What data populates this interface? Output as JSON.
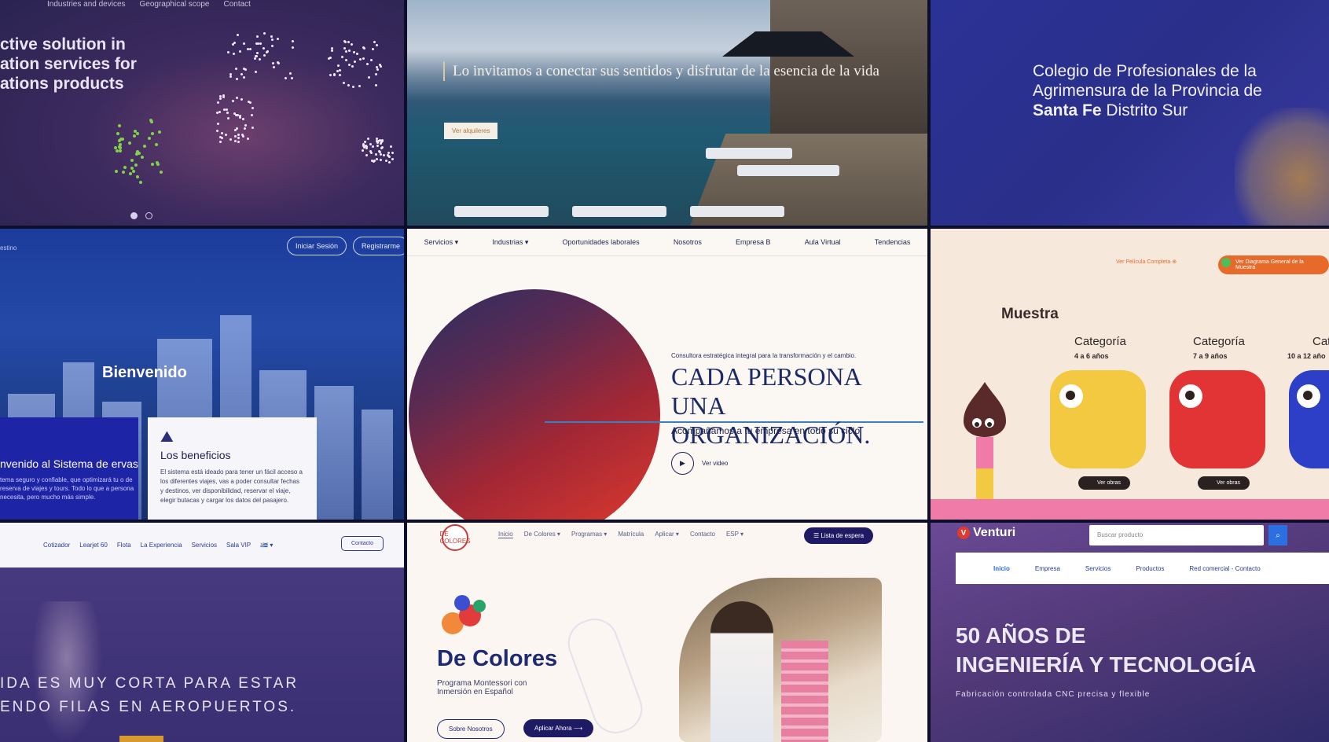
{
  "tiles": {
    "t1": {
      "nav": [
        "Industries and devices",
        "Geographical scope",
        "Contact"
      ],
      "headline": [
        "ctive solution in",
        "ation services for",
        "ations products"
      ]
    },
    "t2": {
      "headline": "Lo invitamos a conectar sus sentidos y disfrutar de la esencia de la vida",
      "button": "Ver alquileres"
    },
    "t3": {
      "headline_a": "Colegio de Profesionales de la Agrimensura de la Provincia de",
      "headline_b": "Santa Fe",
      "headline_c": " Distrito Sur"
    },
    "t4": {
      "brand": "estino",
      "login": "Iniciar Sesión",
      "register": "Registrarme",
      "welcome": "Bienvenido",
      "card_a_title": "nvenido al Sistema de ervas",
      "card_a_text": "tema seguro y confiable, que optimizará tu o de reserva de viajes y tours. Todo lo que a persona necesita, pero mucho más simple.",
      "card_b_title": "Los beneficios",
      "card_b_text": "El sistema está ideado para tener un fácil acceso a los diferentes viajes, vas a poder consultar fechas y destinos, ver disponibilidad, reservar el viaje, elegir butacas y cargar los datos del pasajero."
    },
    "t5": {
      "nav": [
        "Servicios ▾",
        "Industrias ▾",
        "Oportunidades laborales",
        "Nosotros",
        "Empresa B",
        "Aula Virtual",
        "Tendencias"
      ],
      "kicker": "Consultora estratégica integral para la transformación y el cambio.",
      "big_line1": "CADA PERSONA",
      "big_line2": "UNA ORGANIZACIÓN.",
      "sub": "Acompañamos a tu empresa en todo su ciclo",
      "video": "Ver video"
    },
    "t6": {
      "link": "Ver Película Completa",
      "pill": "Ver Diagrama General de la Muestra",
      "muestra": "Muestra",
      "categories": [
        {
          "title": "Categoría",
          "age": "4 a 6 años",
          "color": "#f2c940"
        },
        {
          "title": "Categoría",
          "age": "7 a 9 años",
          "color": "#e23434"
        },
        {
          "title": "Categ",
          "age": "10 a 12 año",
          "color": "#2c3fc6"
        }
      ],
      "obras": "Ver obras"
    },
    "t7": {
      "nav": [
        "Cotizador",
        "Learjet 60",
        "Flota",
        "La Experiencia",
        "Servicios",
        "Sala VIP",
        "🇺🇾 ▾"
      ],
      "contact": "Contacto",
      "phrase_1": "IDA ES MUY CORTA PARA ESTAR",
      "phrase_2": "ENDO FILAS EN AEROPUERTOS."
    },
    "t8": {
      "logo": "DE COLORES",
      "nav": [
        "Inicio",
        "De Colores ▾",
        "Programas ▾",
        "Matrícula",
        "Aplicar ▾",
        "Contacto",
        "ESP ▾"
      ],
      "waitlist": "☰ Lista de espera",
      "title": "De Colores",
      "desc_1": "Programa Montessori con",
      "desc_2": "Inmersión en Español",
      "btn_about": "Sobre Nosotros",
      "btn_apply": "Aplicar Ahora ⟶"
    },
    "t9": {
      "brand": "Venturi",
      "search_placeholder": "Buscar producto",
      "menu": [
        "Inicio",
        "Empresa",
        "Servicios",
        "Productos",
        "Red comercial - Contacto"
      ],
      "big_1": "50 AÑOS DE",
      "big_2": "INGENIERÍA Y TECNOLOGÍA",
      "sub": "Fabricación controlada CNC precisa y flexible"
    }
  }
}
